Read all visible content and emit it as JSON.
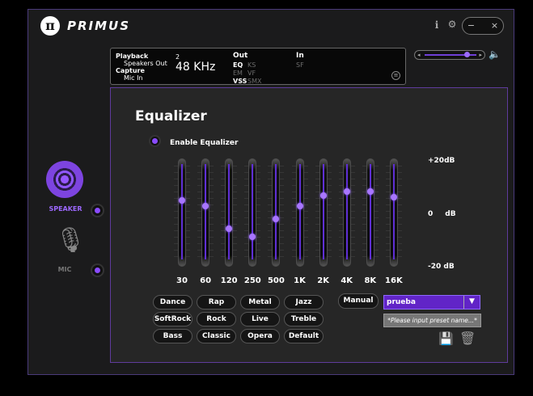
{
  "app": {
    "brand": "PRIMUS",
    "logo_glyph": "π",
    "controls": {
      "info": "i",
      "settings": "⚙",
      "minimize": "−",
      "close": "×"
    }
  },
  "status": {
    "playback_label": "Playback",
    "playback_device": "Speakers Out",
    "capture_label": "Capture",
    "capture_device": "Mic In",
    "channels": "2",
    "sample_rate": "48 KHz",
    "out_label": "Out",
    "out_eq": "EQ",
    "out_ks": "KS",
    "out_em": "EM",
    "out_vf": "VF",
    "out_vss": "VSS",
    "out_smx": "SMX",
    "in_label": "In",
    "in_sf": "SF"
  },
  "volume": {
    "left_glyph": "◂",
    "right_glyph": "▸",
    "level": 0.82
  },
  "nav": {
    "speaker_label": "SPEAKER",
    "mic_label": "MIC"
  },
  "equalizer": {
    "title": "Equalizer",
    "enable_label": "Enable Equalizer",
    "db_top": "+20dB",
    "db_mid_value": "0",
    "db_mid_unit": "dB",
    "db_bottom": "-20 dB",
    "bands": [
      {
        "label": "30",
        "level": 0.62
      },
      {
        "label": "60",
        "level": 0.56
      },
      {
        "label": "120",
        "level": 0.32
      },
      {
        "label": "250",
        "level": 0.24
      },
      {
        "label": "500",
        "level": 0.42
      },
      {
        "label": "1K",
        "level": 0.56
      },
      {
        "label": "2K",
        "level": 0.67
      },
      {
        "label": "4K",
        "level": 0.71
      },
      {
        "label": "8K",
        "level": 0.71
      },
      {
        "label": "16K",
        "level": 0.65
      }
    ]
  },
  "presets": {
    "buttons": [
      "Dance",
      "Rap",
      "Metal",
      "Jazz",
      "SoftRock",
      "Rock",
      "Live",
      "Treble",
      "Bass",
      "Classic",
      "Opera",
      "Default"
    ],
    "manual": "Manual",
    "selected": "prueba",
    "input_placeholder": "*Please input preset name...*"
  }
}
